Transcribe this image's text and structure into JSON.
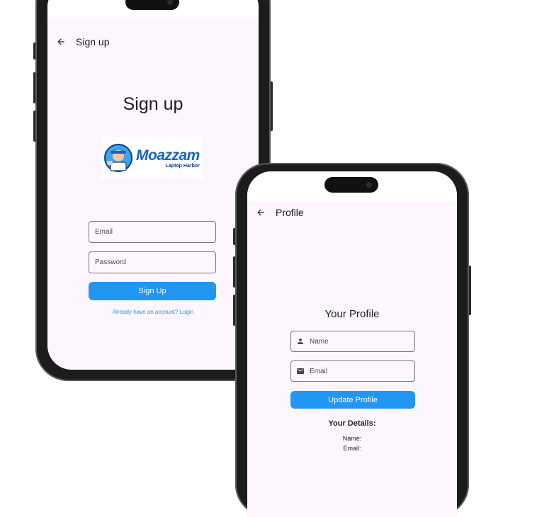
{
  "signup_screen": {
    "appbar_title": "Sign up",
    "heading": "Sign up",
    "logo": {
      "name": "Moazzam",
      "tagline": "Laptop Harbor"
    },
    "email_placeholder": "Email",
    "password_placeholder": "Password",
    "submit_label": "Sign Up",
    "login_link": "Already have an account? Login",
    "icons": {
      "back": "arrow-back-icon"
    }
  },
  "profile_screen": {
    "appbar_title": "Profile",
    "heading": "Your Profile",
    "name_placeholder": "Name",
    "email_placeholder": "Email",
    "update_label": "Update Profile",
    "details_heading": "Your Details:",
    "name_detail": "Name:",
    "email_detail": "Email:",
    "icons": {
      "back": "arrow-back-icon",
      "name": "person-icon",
      "email": "mail-icon"
    }
  },
  "colors": {
    "accent": "#2196f3",
    "screen_bg": "#fdf6fe",
    "frame": "#1c1c1c",
    "logo_blue": "#1565c0"
  }
}
